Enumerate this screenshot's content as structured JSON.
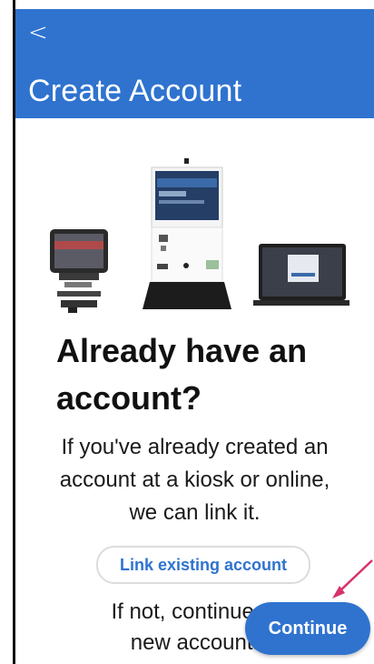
{
  "header": {
    "back_glyph": "<",
    "title": "Create Account"
  },
  "hero": {
    "image_name": "devices-illustration"
  },
  "content": {
    "heading_line1": "Already have an",
    "heading_line2": "account?",
    "body_line1": "If you've already created an",
    "body_line2": "account at a kiosk or online,",
    "body_line3": "we can link it.",
    "link_button": "Link existing account",
    "if_not_line1": "If not, continue to",
    "if_not_line2": "new account."
  },
  "fab": {
    "continue_label": "Continue"
  },
  "colors": {
    "accent": "#2f73cf",
    "annotation_arrow": "#d6336c"
  }
}
